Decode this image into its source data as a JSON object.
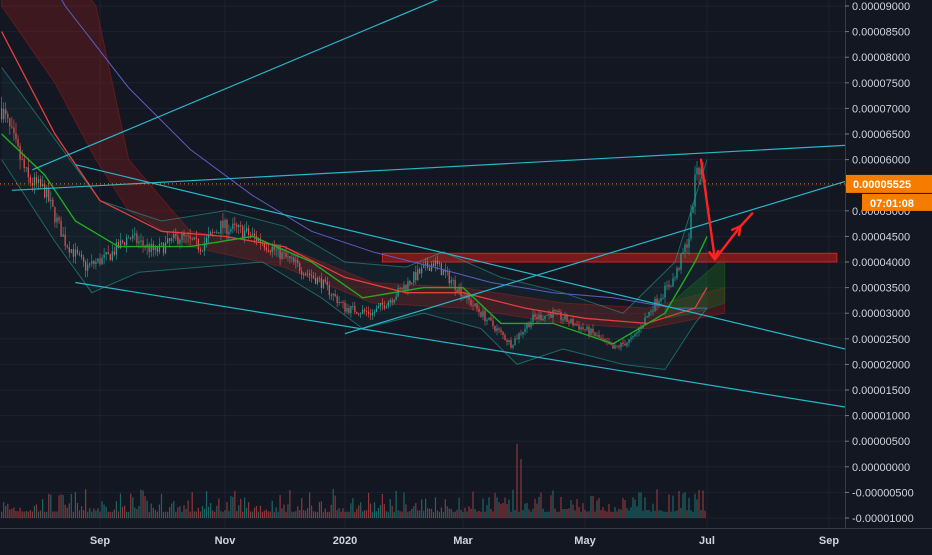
{
  "chart_data": {
    "type": "candlestick",
    "instrument_quote": "BTC",
    "y_axis": {
      "ylim": [
        -1.05e-05,
        9.1e-06
      ],
      "tick_labels": [
        "0.00009000",
        "0.00008500",
        "0.00008000",
        "0.00007500",
        "0.00007000",
        "0.00006500",
        "0.00006000",
        "0.00005500",
        "0.00005000",
        "0.00004500",
        "0.00004000",
        "0.00003500",
        "0.00003000",
        "0.00002500",
        "0.00002000",
        "0.00001500",
        "0.00001000",
        "0.00000500",
        "0.00000000",
        "-0.00000500",
        "-0.00001000"
      ],
      "tick_values": [
        9e-05,
        8.5e-05,
        8e-05,
        7.5e-05,
        7e-05,
        6.5e-05,
        6e-05,
        5.5e-05,
        5e-05,
        4.5e-05,
        4e-05,
        3.5e-05,
        3e-05,
        2.5e-05,
        2e-05,
        1.5e-05,
        1e-05,
        5e-06,
        0.0,
        -5e-06,
        -1e-05
      ]
    },
    "x_axis": {
      "tick_labels": [
        "Sep",
        "Nov",
        "2020",
        "Mar",
        "May",
        "Jul",
        "Sep"
      ],
      "tick_dates": [
        "2019-09-01",
        "2019-11-01",
        "2020-01-01",
        "2020-03-01",
        "2020-05-01",
        "2020-07-01",
        "2020-09-01"
      ],
      "xlim": [
        "2019-07-15",
        "2020-09-20"
      ]
    },
    "last_price": {
      "label": "0.00005525",
      "value": 5.525e-05,
      "color": "#f57c00"
    },
    "countdown": {
      "label": "07:01:08",
      "color": "#f57c00"
    },
    "price_path": [
      [
        "2019-07-15",
        7e-05
      ],
      [
        "2019-07-28",
        5.6e-05
      ],
      [
        "2019-08-05",
        5.4e-05
      ],
      [
        "2019-08-15",
        4.4e-05
      ],
      [
        "2019-08-25",
        3.9e-05
      ],
      [
        "2019-09-05",
        4.1e-05
      ],
      [
        "2019-09-15",
        4.5e-05
      ],
      [
        "2019-09-28",
        4.2e-05
      ],
      [
        "2019-10-10",
        4.5e-05
      ],
      [
        "2019-10-20",
        4.3e-05
      ],
      [
        "2019-10-30",
        4.7e-05
      ],
      [
        "2019-11-10",
        4.6e-05
      ],
      [
        "2019-11-20",
        4.4e-05
      ],
      [
        "2019-12-05",
        4e-05
      ],
      [
        "2019-12-20",
        3.6e-05
      ],
      [
        "2020-01-01",
        3.1e-05
      ],
      [
        "2020-01-15",
        3e-05
      ],
      [
        "2020-01-25",
        3.3e-05
      ],
      [
        "2020-02-05",
        3.7e-05
      ],
      [
        "2020-02-15",
        4e-05
      ],
      [
        "2020-02-25",
        3.6e-05
      ],
      [
        "2020-03-05",
        3.2e-05
      ],
      [
        "2020-03-15",
        2.8e-05
      ],
      [
        "2020-03-25",
        2.4e-05
      ],
      [
        "2020-04-05",
        2.9e-05
      ],
      [
        "2020-04-15",
        3e-05
      ],
      [
        "2020-04-25",
        2.8e-05
      ],
      [
        "2020-05-05",
        2.6e-05
      ],
      [
        "2020-05-15",
        2.3e-05
      ],
      [
        "2020-05-25",
        2.5e-05
      ],
      [
        "2020-06-05",
        3.2e-05
      ],
      [
        "2020-06-15",
        3.7e-05
      ],
      [
        "2020-06-22",
        4.5e-05
      ],
      [
        "2020-06-26",
        5.9e-05
      ],
      [
        "2020-06-30",
        5.525e-05
      ]
    ],
    "overlays": {
      "ma_fast": {
        "color": "#22ab22",
        "points": [
          [
            "2019-07-15",
            6.5e-05
          ],
          [
            "2019-08-05",
            5.7e-05
          ],
          [
            "2019-08-20",
            4.8e-05
          ],
          [
            "2019-09-10",
            4.3e-05
          ],
          [
            "2019-10-15",
            4.3e-05
          ],
          [
            "2019-11-15",
            4.5e-05
          ],
          [
            "2019-12-15",
            4e-05
          ],
          [
            "2020-01-10",
            3.3e-05
          ],
          [
            "2020-02-10",
            3.5e-05
          ],
          [
            "2020-03-01",
            3.5e-05
          ],
          [
            "2020-03-20",
            2.8e-05
          ],
          [
            "2020-04-15",
            2.8e-05
          ],
          [
            "2020-05-15",
            2.4e-05
          ],
          [
            "2020-06-10",
            3e-05
          ],
          [
            "2020-06-25",
            4e-05
          ],
          [
            "2020-07-01",
            4.5e-05
          ]
        ]
      },
      "ma_slow": {
        "color": "#e33f3f",
        "points": [
          [
            "2019-07-15",
            8.5e-05
          ],
          [
            "2019-08-10",
            6.5e-05
          ],
          [
            "2019-09-01",
            5.2e-05
          ],
          [
            "2019-10-01",
            4.6e-05
          ],
          [
            "2019-11-01",
            4.5e-05
          ],
          [
            "2019-12-01",
            4.3e-05
          ],
          [
            "2020-01-01",
            3.7e-05
          ],
          [
            "2020-02-01",
            3.4e-05
          ],
          [
            "2020-03-01",
            3.4e-05
          ],
          [
            "2020-04-01",
            3.1e-05
          ],
          [
            "2020-05-01",
            2.9e-05
          ],
          [
            "2020-06-01",
            2.8e-05
          ],
          [
            "2020-06-25",
            3.1e-05
          ],
          [
            "2020-07-01",
            3.5e-05
          ]
        ]
      },
      "ma_long": {
        "color": "#5b5ec2",
        "points": [
          [
            "2019-07-15",
            0.000112
          ],
          [
            "2019-08-15",
            9e-05
          ],
          [
            "2019-09-15",
            7.4e-05
          ],
          [
            "2019-10-15",
            6.2e-05
          ],
          [
            "2019-11-15",
            5.3e-05
          ],
          [
            "2019-12-15",
            4.6e-05
          ],
          [
            "2020-01-15",
            4.2e-05
          ],
          [
            "2020-02-15",
            3.9e-05
          ],
          [
            "2020-03-15",
            3.6e-05
          ],
          [
            "2020-04-15",
            3.4e-05
          ],
          [
            "2020-05-15",
            3.3e-05
          ],
          [
            "2020-06-15",
            3.1e-05
          ],
          [
            "2020-07-01",
            3.1e-05
          ]
        ]
      },
      "bb_upper": {
        "color": "#26a69a",
        "points": [
          [
            "2019-07-15",
            7.8e-05
          ],
          [
            "2019-08-10",
            6.4e-05
          ],
          [
            "2019-09-01",
            5.2e-05
          ],
          [
            "2019-10-01",
            4.8e-05
          ],
          [
            "2019-11-01",
            5e-05
          ],
          [
            "2019-12-01",
            4.7e-05
          ],
          [
            "2020-01-01",
            4e-05
          ],
          [
            "2020-02-01",
            3.9e-05
          ],
          [
            "2020-02-20",
            4.2e-05
          ],
          [
            "2020-03-20",
            3.7e-05
          ],
          [
            "2020-04-20",
            3.4e-05
          ],
          [
            "2020-05-20",
            3e-05
          ],
          [
            "2020-06-15",
            4e-05
          ],
          [
            "2020-07-01",
            6e-05
          ]
        ]
      },
      "bb_lower": {
        "color": "#26a69a",
        "points": [
          [
            "2019-07-15",
            6e-05
          ],
          [
            "2019-08-10",
            4.4e-05
          ],
          [
            "2019-08-28",
            3.4e-05
          ],
          [
            "2019-09-20",
            3.8e-05
          ],
          [
            "2019-10-20",
            3.9e-05
          ],
          [
            "2019-11-20",
            4e-05
          ],
          [
            "2019-12-20",
            3.3e-05
          ],
          [
            "2020-01-10",
            2.7e-05
          ],
          [
            "2020-02-10",
            3e-05
          ],
          [
            "2020-03-10",
            2.7e-05
          ],
          [
            "2020-03-28",
            2e-05
          ],
          [
            "2020-04-20",
            2.3e-05
          ],
          [
            "2020-05-20",
            2e-05
          ],
          [
            "2020-06-10",
            1.9e-05
          ],
          [
            "2020-06-25",
            2.8e-05
          ],
          [
            "2020-07-01",
            3.1e-05
          ]
        ]
      },
      "cloud_red": {
        "color": "#8b1a1a",
        "upper": [
          [
            "2019-07-15",
            0.00011
          ],
          [
            "2019-08-10",
            0.0001
          ],
          [
            "2019-08-30",
            9e-05
          ],
          [
            "2019-09-15",
            6e-05
          ],
          [
            "2019-10-15",
            4.6e-05
          ],
          [
            "2019-12-01",
            4.3e-05
          ],
          [
            "2020-01-15",
            3.6e-05
          ],
          [
            "2020-03-01",
            3.5e-05
          ],
          [
            "2020-04-20",
            3.2e-05
          ],
          [
            "2020-06-01",
            3.1e-05
          ],
          [
            "2020-07-10",
            3.5e-05
          ]
        ],
        "lower": [
          [
            "2019-07-15",
            9e-05
          ],
          [
            "2019-08-10",
            7.5e-05
          ],
          [
            "2019-08-30",
            6e-05
          ],
          [
            "2019-09-15",
            5e-05
          ],
          [
            "2019-10-15",
            4.3e-05
          ],
          [
            "2019-12-01",
            3.9e-05
          ],
          [
            "2020-01-15",
            3.2e-05
          ],
          [
            "2020-03-01",
            3.1e-05
          ],
          [
            "2020-04-20",
            2.8e-05
          ],
          [
            "2020-06-01",
            2.7e-05
          ],
          [
            "2020-07-10",
            3e-05
          ]
        ]
      },
      "cloud_green": {
        "color": "#1b5e20",
        "upper": [
          [
            "2020-06-10",
            3.1e-05
          ],
          [
            "2020-06-25",
            3.6e-05
          ],
          [
            "2020-07-10",
            4.1e-05
          ]
        ],
        "lower": [
          [
            "2020-06-10",
            2.9e-05
          ],
          [
            "2020-06-25",
            3e-05
          ],
          [
            "2020-07-10",
            3.2e-05
          ]
        ]
      },
      "resistance_zone": {
        "color": "#8b1a1a",
        "from": "2020-01-20",
        "to": "2020-09-05",
        "top": 4.17e-05,
        "bottom": 4e-05
      }
    },
    "drawings": {
      "line_color": "#29b6c7",
      "lines": [
        [
          [
            "2019-07-20",
            5.4e-05
          ],
          [
            "2020-09-20",
            6.3e-05
          ]
        ],
        [
          [
            "2019-07-30",
            5.8e-05
          ],
          [
            "2020-02-28",
            9.3e-05
          ]
        ],
        [
          [
            "2019-08-20",
            5.9e-05
          ],
          [
            "2020-09-20",
            2.2e-05
          ]
        ],
        [
          [
            "2019-08-20",
            3.6e-05
          ],
          [
            "2020-09-20",
            1.1e-05
          ]
        ],
        [
          [
            "2020-01-01",
            2.6e-05
          ],
          [
            "2020-09-20",
            5.7e-05
          ]
        ]
      ],
      "projection_color": "#ff2222",
      "projection_path": [
        [
          "2020-06-28",
          6e-05
        ],
        [
          "2020-07-05",
          4.05e-05
        ],
        [
          "2020-07-18",
          4.7e-05
        ],
        [
          "2020-07-24",
          4.95e-05
        ]
      ]
    },
    "volume": {
      "positive_color": "#26a69a",
      "negative_color": "#ef5350",
      "base_value": -1e-05,
      "max_value": 1.45e-05
    }
  }
}
